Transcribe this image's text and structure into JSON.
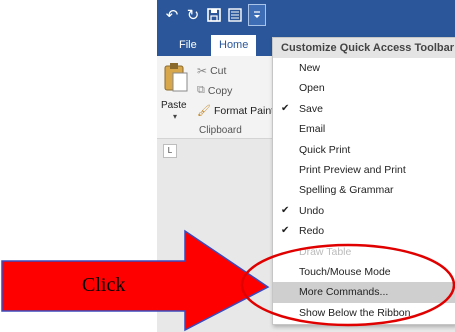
{
  "qat": {
    "undo_icon": "undo-icon",
    "redo_icon": "redo-icon",
    "save_icon": "save-icon",
    "print_icon": "print-preview-icon",
    "dropdown_icon": "customize-dropdown-icon"
  },
  "tabs": [
    {
      "label": "File",
      "active": false
    },
    {
      "label": "Home",
      "active": true
    }
  ],
  "clipboard": {
    "paste_label": "Paste",
    "cut_label": "Cut",
    "copy_label": "Copy",
    "format_painter_label": "Format Paint",
    "group_label": "Clipboard"
  },
  "ruler": {
    "corner_symbol": "L"
  },
  "menu": {
    "title": "Customize Quick Access Toolbar",
    "items": [
      {
        "label": "New",
        "checked": false,
        "state": "normal"
      },
      {
        "label": "Open",
        "checked": false,
        "state": "normal"
      },
      {
        "label": "Save",
        "checked": true,
        "state": "normal"
      },
      {
        "label": "Email",
        "checked": false,
        "state": "normal"
      },
      {
        "label": "Quick Print",
        "checked": false,
        "state": "normal"
      },
      {
        "label": "Print Preview and Print",
        "checked": false,
        "state": "normal"
      },
      {
        "label": "Spelling & Grammar",
        "checked": false,
        "state": "normal"
      },
      {
        "label": "Undo",
        "checked": true,
        "state": "normal"
      },
      {
        "label": "Redo",
        "checked": true,
        "state": "normal"
      },
      {
        "label": "Draw Table",
        "checked": false,
        "state": "obscured"
      },
      {
        "label": "Touch/Mouse Mode",
        "checked": false,
        "state": "normal"
      },
      {
        "label": "More Commands...",
        "checked": false,
        "state": "highlighted"
      },
      {
        "label": "Show Below the Ribbon",
        "checked": false,
        "state": "normal"
      }
    ]
  },
  "annotation": {
    "label": "Click",
    "arrow_color": "#ff0000",
    "arrow_outline": "#3a4bbd",
    "ellipse_color": "#e00000"
  },
  "colors": {
    "title_bar": "#2b579a",
    "ribbon_bg": "#f3f3f3",
    "menu_highlight": "#cfcfcf"
  }
}
